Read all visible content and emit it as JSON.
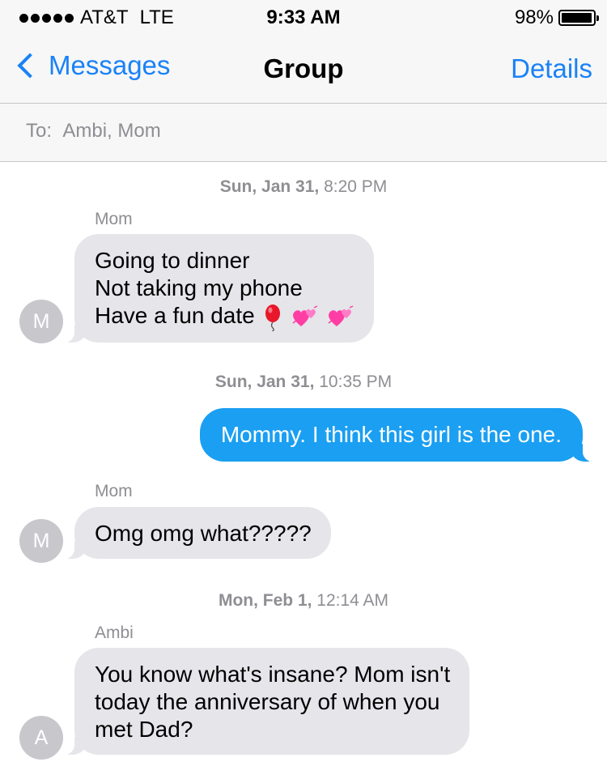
{
  "status_bar": {
    "carrier": "AT&T",
    "network": "LTE",
    "time": "9:33 AM",
    "battery_percent": "98%",
    "battery_level": 0.98
  },
  "nav": {
    "back_label": "Messages",
    "title": "Group",
    "details_label": "Details"
  },
  "recipients": {
    "label": "To:",
    "names": "Ambi, Mom"
  },
  "messages": [
    {
      "timestamp_day": "Sun, Jan 31,",
      "timestamp_time": "8:20 PM",
      "sender": "Mom",
      "avatar_initial": "M",
      "lines": [
        "Going to dinner",
        "Not taking my phone",
        "Have a fun date"
      ],
      "emojis": [
        "balloon-icon",
        "two-hearts-icon",
        "two-hearts-icon"
      ]
    },
    {
      "timestamp_day": "Sun, Jan 31,",
      "timestamp_time": "10:35 PM",
      "text": "Mommy. I think this girl is the one."
    },
    {
      "sender": "Mom",
      "avatar_initial": "M",
      "text": "Omg omg what?????"
    },
    {
      "timestamp_day": "Mon, Feb 1,",
      "timestamp_time": "12:14 AM",
      "sender": "Ambi",
      "avatar_initial": "A",
      "lines": [
        "You know what's insane? Mom isn't",
        "today the anniversary of when you",
        "met Dad?"
      ]
    }
  ],
  "colors": {
    "accent": "#1a82f7",
    "outgoing_bubble": "#1a9ff2",
    "incoming_bubble": "#e5e5ea",
    "secondary_text": "#8e8e93",
    "avatar_bg": "#c7c7cc"
  }
}
